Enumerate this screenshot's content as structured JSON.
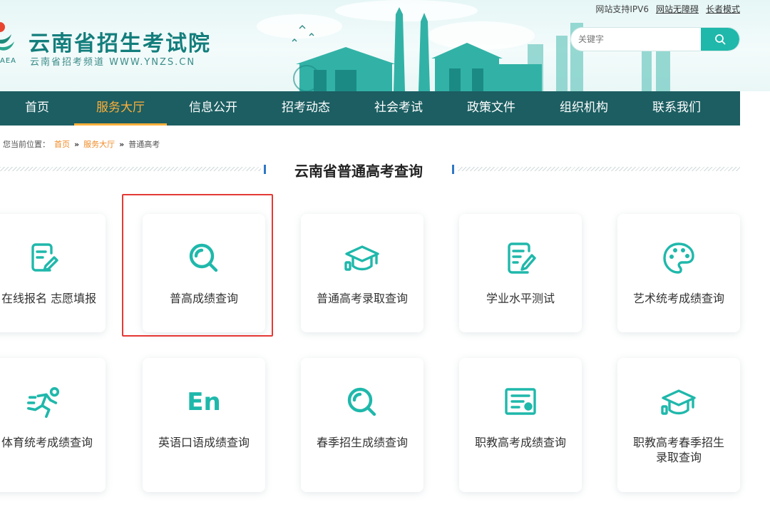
{
  "header": {
    "title": "云南省招生考试院",
    "subtitle": "云南省招考频道 WWW.YNZS.CN",
    "logo_abbr": "AEA",
    "top_links": {
      "ipv6": "网站支持IPV6",
      "accessible": "网站无障碍",
      "elder_mode": "长者模式"
    },
    "search": {
      "placeholder": "关键字",
      "icon": "search-icon"
    }
  },
  "nav": {
    "items": [
      "首页",
      "服务大厅",
      "信息公开",
      "招考动态",
      "社会考试",
      "政策文件",
      "组织机构",
      "联系我们"
    ],
    "active_index": 1
  },
  "breadcrumb": {
    "prefix": "您当前位置：",
    "items": [
      "首页",
      "服务大厅",
      "普通高考"
    ],
    "separator": "»"
  },
  "section": {
    "title": "云南省普通高考查询"
  },
  "cards": [
    {
      "label": "在线报名 志愿填报",
      "icon": "edit-document-icon"
    },
    {
      "label": "普高成绩查询",
      "icon": "search-icon",
      "highlighted": true
    },
    {
      "label": "普通高考录取查询",
      "icon": "graduation-cap-icon"
    },
    {
      "label": "学业水平测试",
      "icon": "document-edit-icon"
    },
    {
      "label": "艺术统考成绩查询",
      "icon": "palette-icon"
    },
    {
      "label": "体育统考成绩查询",
      "icon": "running-person-icon"
    },
    {
      "label": "英语口语成绩查询",
      "icon": "en-text-icon",
      "icon_text": "En"
    },
    {
      "label": "春季招生成绩查询",
      "icon": "search-icon"
    },
    {
      "label": "职教高考成绩查询",
      "icon": "certificate-icon"
    },
    {
      "label": "职教高考春季招生录取查询",
      "icon": "graduation-cap-icon"
    }
  ],
  "colors": {
    "nav_bg": "#1c5e62",
    "accent": "#ffb03a",
    "icon_teal": "#1fb8ab",
    "brand": "#137e7c",
    "highlight_border": "#e53935",
    "breadcrumb_link": "#f08a24"
  }
}
